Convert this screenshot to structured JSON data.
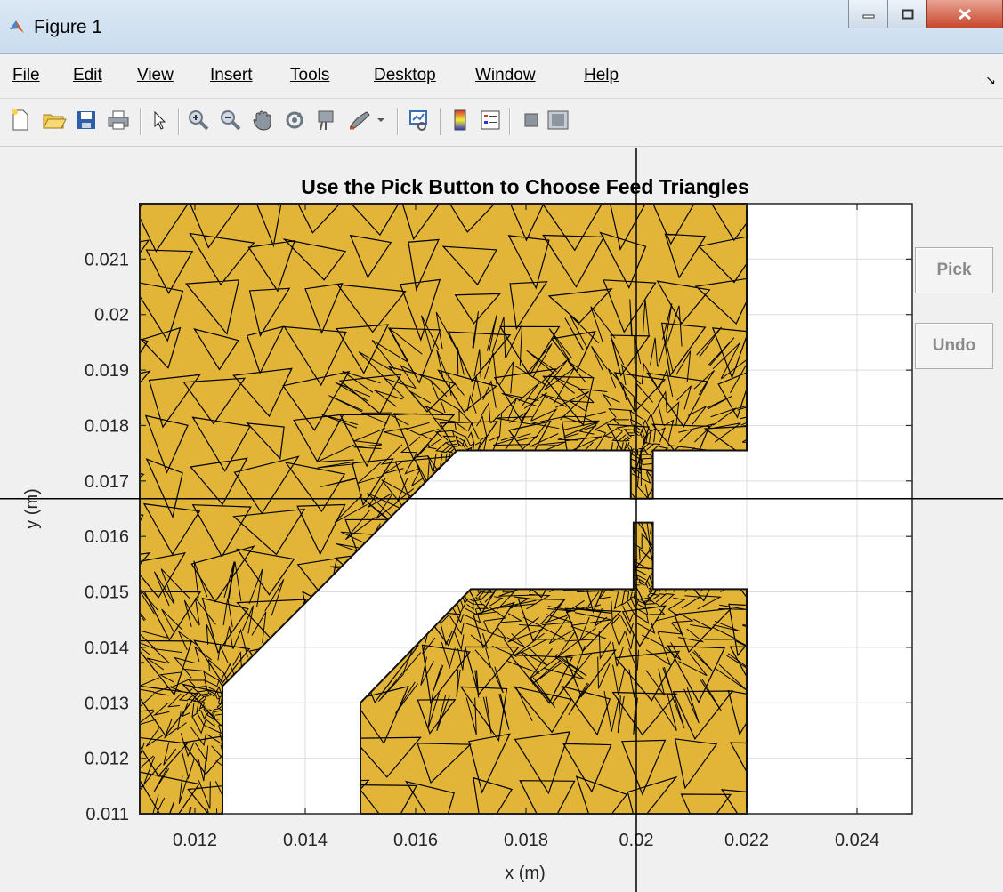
{
  "window": {
    "title": "Figure 1"
  },
  "menu": [
    "File",
    "Edit",
    "View",
    "Insert",
    "Tools",
    "Desktop",
    "Window",
    "Help"
  ],
  "toolbar_icons": [
    "new-figure-icon",
    "open-file-icon",
    "save-icon",
    "print-icon",
    "pointer-icon",
    "zoom-in-icon",
    "zoom-out-icon",
    "pan-icon",
    "rotate-3d-icon",
    "data-cursor-icon",
    "brush-icon",
    "link-plot-icon",
    "colorbar-icon",
    "legend-icon",
    "hide-plot-tools-icon",
    "show-plot-tools-icon"
  ],
  "buttons": {
    "pick": "Pick",
    "undo": "Undo"
  },
  "colors": {
    "mesh_fill": "#e2b437",
    "mesh_edge": "#000000",
    "titlebar": "#dce8f4",
    "close": "#c9462c"
  },
  "chart_data": {
    "type": "mesh",
    "title": "Use the Pick Button to Choose Feed Triangles",
    "xlabel": "x (m)",
    "ylabel": "y (m)",
    "xlim": [
      0.011,
      0.025
    ],
    "ylim": [
      0.011,
      0.022
    ],
    "xticks": [
      0.012,
      0.014,
      0.016,
      0.018,
      0.02,
      0.022,
      0.024
    ],
    "xtick_labels": [
      "0.012",
      "0.014",
      "0.016",
      "0.018",
      "0.02",
      "0.022",
      "0.024"
    ],
    "yticks": [
      0.011,
      0.012,
      0.013,
      0.014,
      0.015,
      0.016,
      0.017,
      0.018,
      0.019,
      0.02,
      0.021
    ],
    "ytick_labels": [
      "0.011",
      "0.012",
      "0.013",
      "0.014",
      "0.015",
      "0.016",
      "0.017",
      "0.018",
      "0.019",
      "0.02",
      "0.021"
    ],
    "grid": true,
    "crosshair": {
      "x": 0.02,
      "y": 0.01668
    },
    "regions": [
      {
        "name": "upper-patch",
        "points": [
          [
            0.011,
            0.022
          ],
          [
            0.022,
            0.022
          ],
          [
            0.022,
            0.01755
          ],
          [
            0.0203,
            0.01755
          ],
          [
            0.0203,
            0.01668
          ],
          [
            0.0199,
            0.01668
          ],
          [
            0.0199,
            0.01755
          ],
          [
            0.01675,
            0.01755
          ],
          [
            0.0125,
            0.0133
          ],
          [
            0.0125,
            0.011
          ],
          [
            0.011,
            0.011
          ]
        ]
      },
      {
        "name": "lower-patch",
        "points": [
          [
            0.015,
            0.011
          ],
          [
            0.022,
            0.011
          ],
          [
            0.022,
            0.01505
          ],
          [
            0.0203,
            0.01505
          ],
          [
            0.0203,
            0.01625
          ],
          [
            0.01995,
            0.01625
          ],
          [
            0.01995,
            0.01505
          ],
          [
            0.017,
            0.01505
          ],
          [
            0.015,
            0.013
          ]
        ]
      }
    ]
  }
}
